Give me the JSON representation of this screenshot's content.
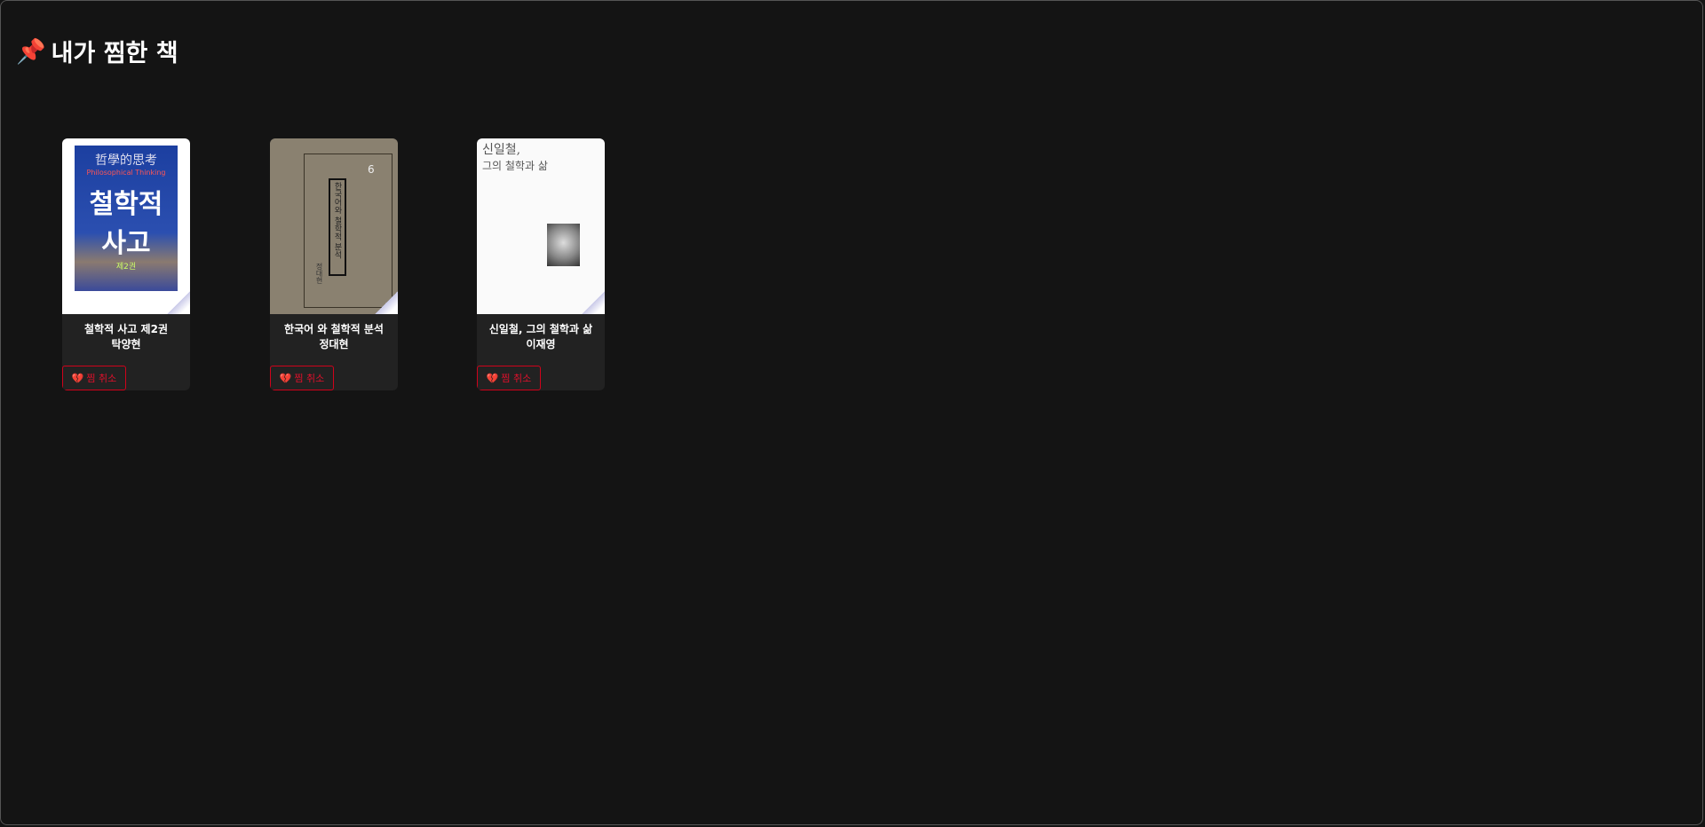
{
  "page": {
    "title": "내가 찜한 책",
    "title_icon": "pushpin-icon"
  },
  "books": [
    {
      "title": "철학적 사고 제2권",
      "author": "탁양현",
      "cover_text": [
        "哲學的思考",
        "Philosophical Thinking",
        "철학적",
        "사고",
        "제2권"
      ],
      "button": "찜 취소"
    },
    {
      "title": "한국어 와 철학적 분석",
      "author": "정대현",
      "cover_text": [
        "6",
        "한국어와 철학적 분석",
        "정대현"
      ],
      "button": "찜 취소"
    },
    {
      "title": "신일철, 그의 철학과 삶",
      "author": "이재영",
      "cover_text": [
        "신일철,",
        "그의 철학과 삶"
      ],
      "button": "찜 취소"
    }
  ],
  "colors": {
    "background": "#141414",
    "card": "#222222",
    "accent": "#d0021b"
  }
}
